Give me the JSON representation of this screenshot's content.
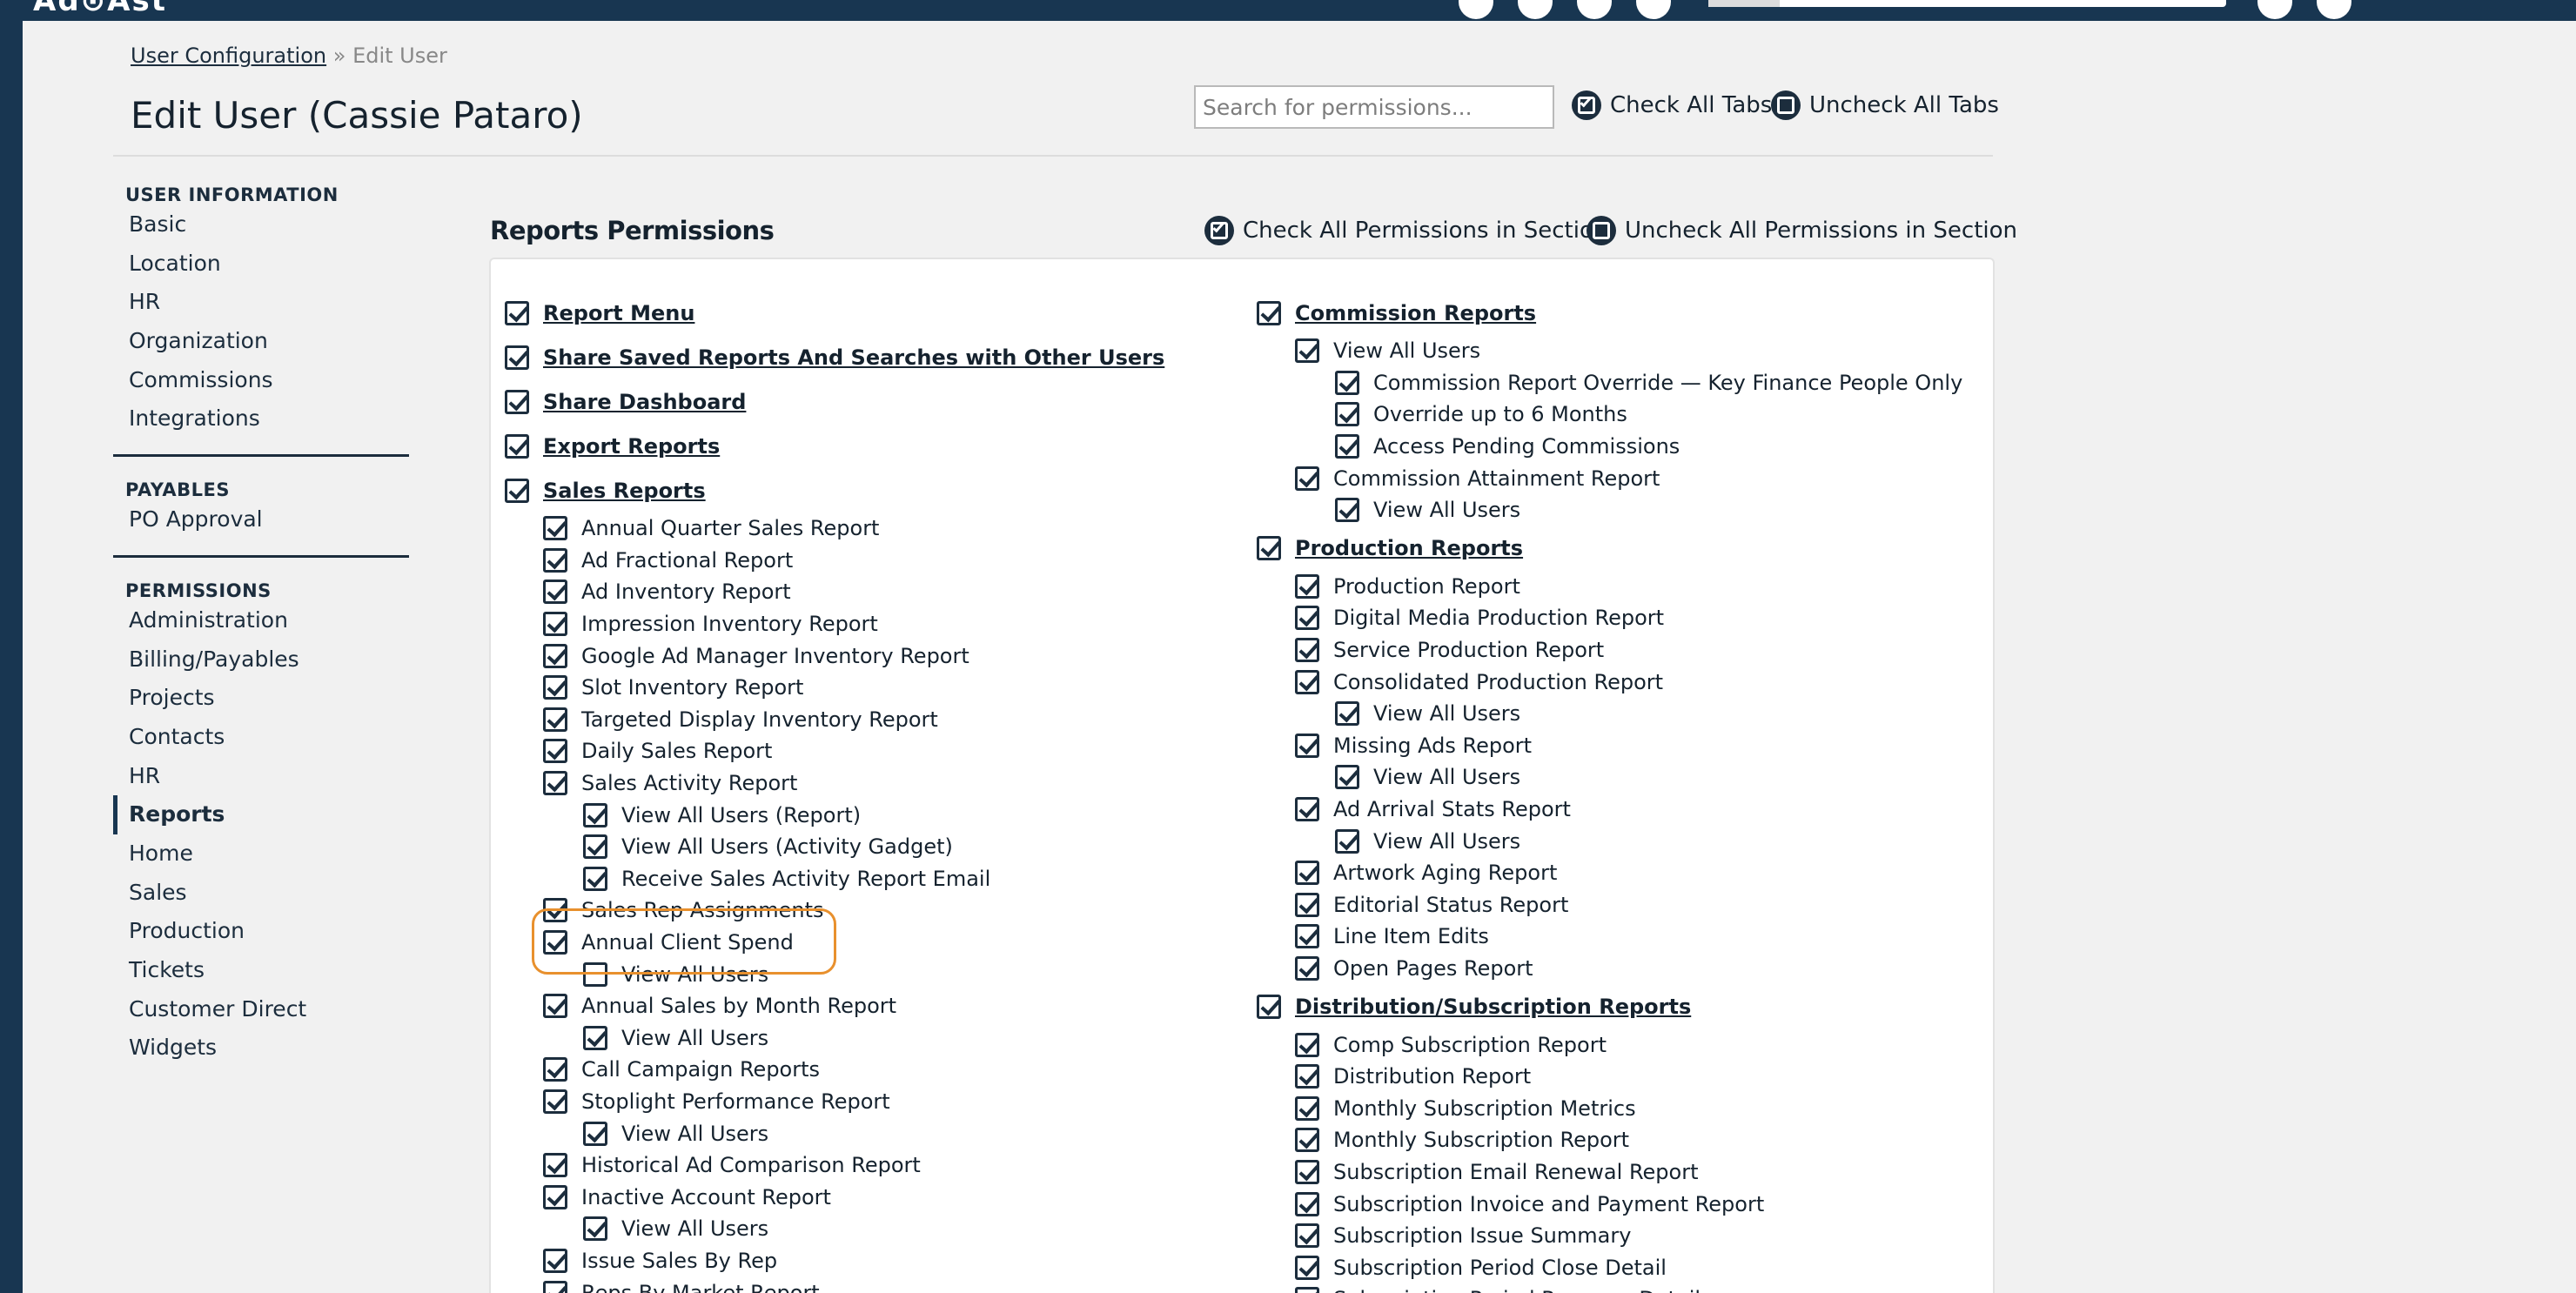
{
  "header": {
    "logo_text": "Ad⊙Ast"
  },
  "breadcrumb": {
    "parent": "User Configuration",
    "separator": "»",
    "current": "Edit User"
  },
  "page_title": "Edit User (Cassie Pataro)",
  "search": {
    "placeholder": "Search for permissions...",
    "value": ""
  },
  "tab_actions": {
    "check_all": "Check All Tabs",
    "uncheck_all": "Uncheck All Tabs"
  },
  "sidebar": {
    "sections": [
      {
        "heading": "USER INFORMATION",
        "items": [
          "Basic",
          "Location",
          "HR",
          "Organization",
          "Commissions",
          "Integrations"
        ]
      },
      {
        "heading": "PAYABLES",
        "items": [
          "PO Approval"
        ]
      },
      {
        "heading": "PERMISSIONS",
        "items": [
          "Administration",
          "Billing/Payables",
          "Projects",
          "Contacts",
          "HR",
          "Reports",
          "Home",
          "Sales",
          "Production",
          "Tickets",
          "Customer Direct",
          "Widgets"
        ]
      }
    ],
    "active_item": "Reports"
  },
  "section": {
    "title": "Reports Permissions",
    "check_all": "Check All Permissions in Section",
    "uncheck_all": "Uncheck All Permissions in Section"
  },
  "left_column": [
    {
      "label": "Report Menu",
      "level": 0,
      "checked": true
    },
    {
      "label": "Share Saved Reports And Searches with Other Users",
      "level": 0,
      "checked": true
    },
    {
      "label": "Share Dashboard",
      "level": 0,
      "checked": true
    },
    {
      "label": "Export Reports",
      "level": 0,
      "checked": true
    },
    {
      "label": "Sales Reports",
      "level": 0,
      "checked": true
    },
    {
      "label": "Annual Quarter Sales Report",
      "level": 1,
      "checked": true
    },
    {
      "label": "Ad Fractional Report",
      "level": 1,
      "checked": true
    },
    {
      "label": "Ad Inventory Report",
      "level": 1,
      "checked": true
    },
    {
      "label": "Impression Inventory Report",
      "level": 1,
      "checked": true
    },
    {
      "label": "Google Ad Manager Inventory Report",
      "level": 1,
      "checked": true
    },
    {
      "label": "Slot Inventory Report",
      "level": 1,
      "checked": true
    },
    {
      "label": "Targeted Display Inventory Report",
      "level": 1,
      "checked": true
    },
    {
      "label": "Daily Sales Report",
      "level": 1,
      "checked": true
    },
    {
      "label": "Sales Activity Report",
      "level": 1,
      "checked": true
    },
    {
      "label": "View All Users (Report)",
      "level": 2,
      "checked": true
    },
    {
      "label": "View All Users (Activity Gadget)",
      "level": 2,
      "checked": true
    },
    {
      "label": "Receive Sales Activity Report Email",
      "level": 2,
      "checked": true
    },
    {
      "label": "Sales Rep Assignments",
      "level": 1,
      "checked": true
    },
    {
      "label": "Annual Client Spend",
      "level": 1,
      "checked": true
    },
    {
      "label": "View All Users",
      "level": 2,
      "checked": false
    },
    {
      "label": "Annual Sales by Month Report",
      "level": 1,
      "checked": true
    },
    {
      "label": "View All Users",
      "level": 2,
      "checked": true
    },
    {
      "label": "Call Campaign Reports",
      "level": 1,
      "checked": true
    },
    {
      "label": "Stoplight Performance Report",
      "level": 1,
      "checked": true
    },
    {
      "label": "View All Users",
      "level": 2,
      "checked": true
    },
    {
      "label": "Historical Ad Comparison Report",
      "level": 1,
      "checked": true
    },
    {
      "label": "Inactive Account Report",
      "level": 1,
      "checked": true
    },
    {
      "label": "View All Users",
      "level": 2,
      "checked": true
    },
    {
      "label": "Issue Sales By Rep",
      "level": 1,
      "checked": true
    },
    {
      "label": "Reps By Market Report",
      "level": 1,
      "checked": true
    }
  ],
  "right_column": [
    {
      "label": "Commission Reports",
      "level": 0,
      "checked": true
    },
    {
      "label": "View All Users",
      "level": 1,
      "checked": true
    },
    {
      "label": "Commission Report Override — Key Finance People Only",
      "level": 2,
      "checked": true
    },
    {
      "label": "Override up to 6 Months",
      "level": 2,
      "checked": true
    },
    {
      "label": "Access Pending Commissions",
      "level": 2,
      "checked": true
    },
    {
      "label": "Commission Attainment Report",
      "level": 1,
      "checked": true
    },
    {
      "label": "View All Users",
      "level": 2,
      "checked": true
    },
    {
      "label": "Production Reports",
      "level": 0,
      "checked": true
    },
    {
      "label": "Production Report",
      "level": 1,
      "checked": true
    },
    {
      "label": "Digital Media Production Report",
      "level": 1,
      "checked": true
    },
    {
      "label": "Service Production Report",
      "level": 1,
      "checked": true
    },
    {
      "label": "Consolidated Production Report",
      "level": 1,
      "checked": true
    },
    {
      "label": "View All Users",
      "level": 2,
      "checked": true
    },
    {
      "label": "Missing Ads Report",
      "level": 1,
      "checked": true
    },
    {
      "label": "View All Users",
      "level": 2,
      "checked": true
    },
    {
      "label": "Ad Arrival Stats Report",
      "level": 1,
      "checked": true
    },
    {
      "label": "View All Users",
      "level": 2,
      "checked": true
    },
    {
      "label": "Artwork Aging Report",
      "level": 1,
      "checked": true
    },
    {
      "label": "Editorial Status Report",
      "level": 1,
      "checked": true
    },
    {
      "label": "Line Item Edits",
      "level": 1,
      "checked": true
    },
    {
      "label": "Open Pages Report",
      "level": 1,
      "checked": true
    },
    {
      "label": "Distribution/Subscription Reports",
      "level": 0,
      "checked": true
    },
    {
      "label": "Comp Subscription Report",
      "level": 1,
      "checked": true
    },
    {
      "label": "Distribution Report",
      "level": 1,
      "checked": true
    },
    {
      "label": "Monthly Subscription Metrics",
      "level": 1,
      "checked": true
    },
    {
      "label": "Monthly Subscription Report",
      "level": 1,
      "checked": true
    },
    {
      "label": "Subscription Email Renewal Report",
      "level": 1,
      "checked": true
    },
    {
      "label": "Subscription Invoice and Payment Report",
      "level": 1,
      "checked": true
    },
    {
      "label": "Subscription Issue Summary",
      "level": 1,
      "checked": true
    },
    {
      "label": "Subscription Period Close Detail",
      "level": 1,
      "checked": true
    },
    {
      "label": "Subscription Period Revenue Detail",
      "level": 1,
      "checked": true
    }
  ],
  "colors": {
    "navy": "#183651",
    "text": "#1c2d3d",
    "highlight": "#e8902d",
    "background": "#f1f1f1"
  }
}
